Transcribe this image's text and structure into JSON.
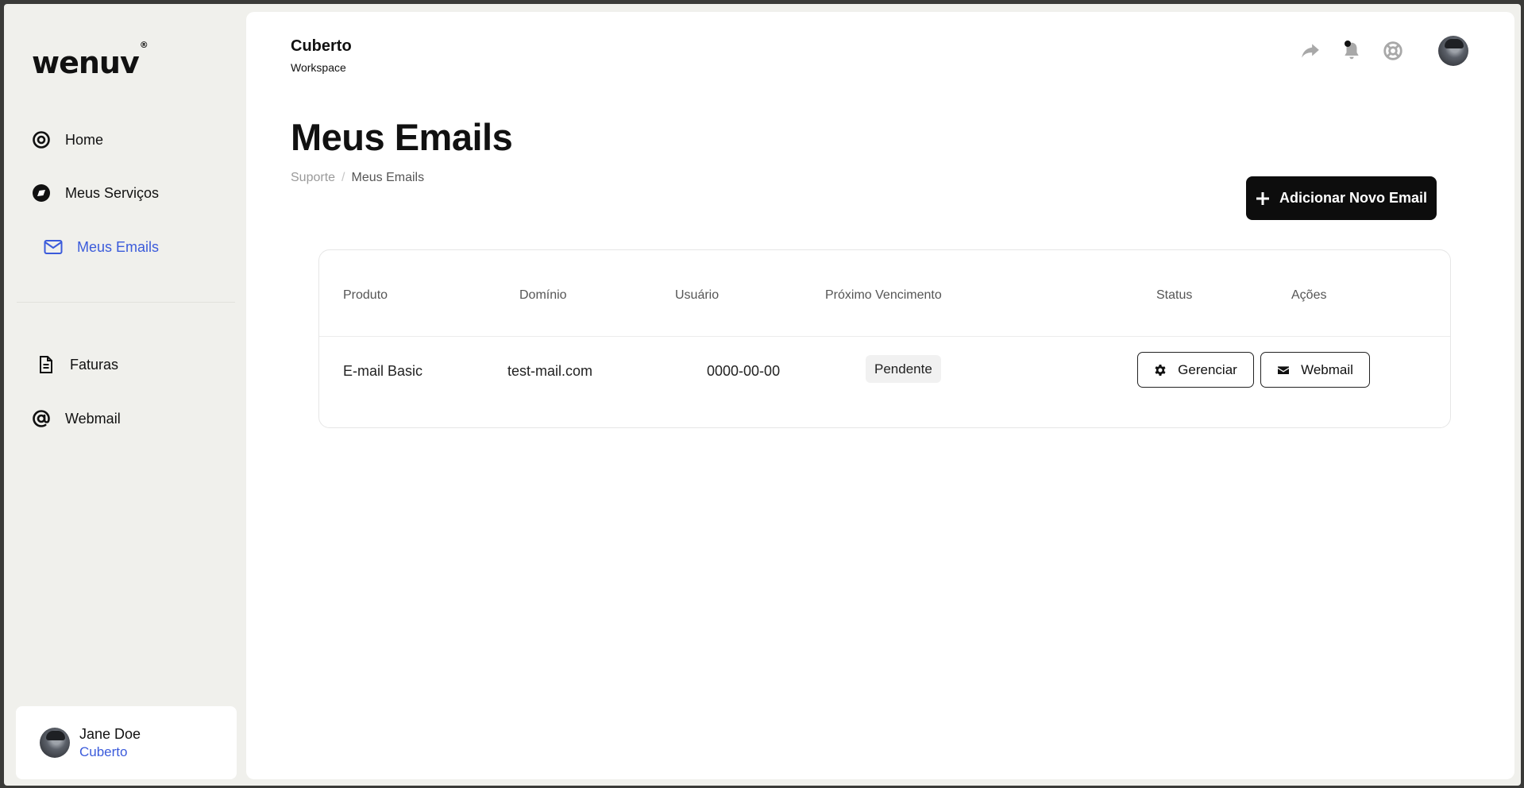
{
  "brand": {
    "logo_text": "wenuv",
    "logo_mark": "®"
  },
  "sidebar": {
    "items": [
      {
        "label": "Home",
        "icon": "target-icon"
      },
      {
        "label": "Meus Serviços",
        "icon": "compass-icon"
      },
      {
        "label": "Meus Emails",
        "icon": "mail-icon",
        "active": true
      },
      {
        "label": "Faturas",
        "icon": "document-icon"
      },
      {
        "label": "Webmail",
        "icon": "at-icon"
      }
    ]
  },
  "user": {
    "name": "Jane Doe",
    "org": "Cuberto"
  },
  "workspace": {
    "name": "Cuberto",
    "label": "Workspace"
  },
  "page": {
    "title": "Meus Emails",
    "breadcrumb": [
      "Suporte",
      "Meus Emails"
    ],
    "breadcrumb_sep": "/",
    "add_button_label": "Adicionar Novo Email"
  },
  "table": {
    "headers": [
      "Produto",
      "Domínio",
      "Usuário",
      "Próximo Vencimento",
      "Status",
      "Ações"
    ],
    "rows": [
      {
        "product": "E-mail Basic",
        "domain": "test-mail.com",
        "user": "0000-00-00",
        "status": "Pendente",
        "actions": [
          "Gerenciar",
          "Webmail"
        ]
      }
    ]
  },
  "colors": {
    "accent": "#3b5bdb",
    "primary_button": "#0d0d0d",
    "sidebar_bg": "#f0f0ec"
  }
}
